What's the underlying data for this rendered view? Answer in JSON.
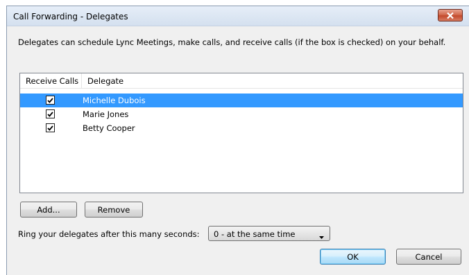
{
  "window": {
    "title": "Call Forwarding - Delegates",
    "close_icon": "close-icon"
  },
  "description": "Delegates can schedule Lync Meetings, make calls, and receive calls (if the box is checked) on your behalf.",
  "delegates_list": {
    "columns": [
      "Receive Calls",
      "Delegate"
    ],
    "rows": [
      {
        "receive_calls": true,
        "delegate": "Michelle Dubois",
        "selected": true
      },
      {
        "receive_calls": true,
        "delegate": "Marie Jones",
        "selected": false
      },
      {
        "receive_calls": true,
        "delegate": "Betty Cooper",
        "selected": false
      }
    ]
  },
  "buttons": {
    "add": "Add...",
    "remove": "Remove",
    "ok": "OK",
    "cancel": "Cancel"
  },
  "ring_setting": {
    "label": "Ring your delegates after this many seconds:",
    "selected_value": "0 - at the same time"
  },
  "colors": {
    "selection": "#3399ff",
    "close_button": "#c34a2d"
  }
}
